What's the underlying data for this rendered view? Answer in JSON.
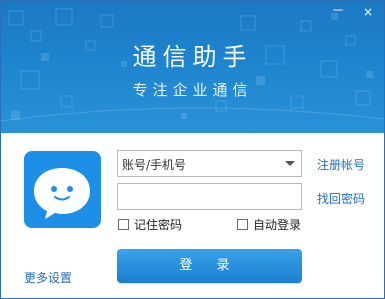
{
  "window": {
    "minimize_label": "－",
    "close_label": "×"
  },
  "banner": {
    "title": "通信助手",
    "subtitle": "专注企业通信"
  },
  "login": {
    "account_value": "账号/手机号",
    "password_value": "",
    "register_label": "注册帐号",
    "forgot_label": "找回密码",
    "remember_label": "记住密码",
    "auto_login_label": "自动登录",
    "more_settings_label": "更多设置",
    "login_button_label": "登 录"
  },
  "icons": {
    "avatar": "chat-bubble-face-icon",
    "dropdown": "chevron-down-icon"
  },
  "colors": {
    "banner": "#1d84cf",
    "link": "#1f6fbf",
    "button": "#2a92e0"
  }
}
